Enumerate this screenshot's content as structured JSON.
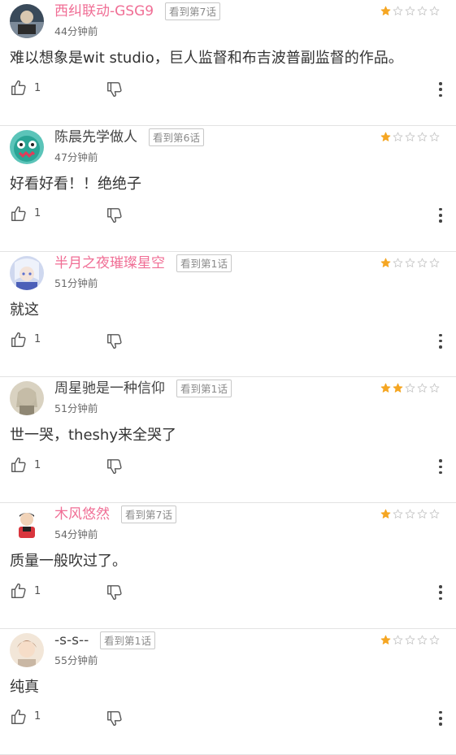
{
  "colors": {
    "pink_name": "#f06e95",
    "gray_name": "#444444",
    "star_filled": "#f5a623",
    "star_empty": "#c8c8c8"
  },
  "reviews": [
    {
      "username": "西纠联动-GSG9",
      "name_style": "pink",
      "episode": "看到第7话",
      "time": "44分钟前",
      "rating": 1,
      "content": "难以想象是wit  studio，巨人监督和布吉波普副监督的作品。",
      "likes": "1",
      "avatar": "avatar-1"
    },
    {
      "username": "陈晨先学做人",
      "name_style": "gray",
      "episode": "看到第6话",
      "time": "47分钟前",
      "rating": 1,
      "content": "好看好看！！绝绝子",
      "likes": "1",
      "avatar": "avatar-2"
    },
    {
      "username": "半月之夜璀璨星空",
      "name_style": "pink",
      "episode": "看到第1话",
      "time": "51分钟前",
      "rating": 1,
      "content": "就这",
      "likes": "1",
      "avatar": "avatar-3"
    },
    {
      "username": "周星驰是一种信仰",
      "name_style": "gray",
      "episode": "看到第1话",
      "time": "51分钟前",
      "rating": 2,
      "content": "世一哭，theshy来全哭了",
      "likes": "1",
      "avatar": "avatar-4"
    },
    {
      "username": "木风悠然",
      "name_style": "pink",
      "episode": "看到第7话",
      "time": "54分钟前",
      "rating": 1,
      "content": "质量一般吹过了。",
      "likes": "1",
      "avatar": "avatar-5"
    },
    {
      "username": "-s-s--",
      "name_style": "gray",
      "episode": "看到第1话",
      "time": "55分钟前",
      "rating": 1,
      "content": "纯真",
      "likes": "1",
      "avatar": "avatar-6"
    }
  ]
}
